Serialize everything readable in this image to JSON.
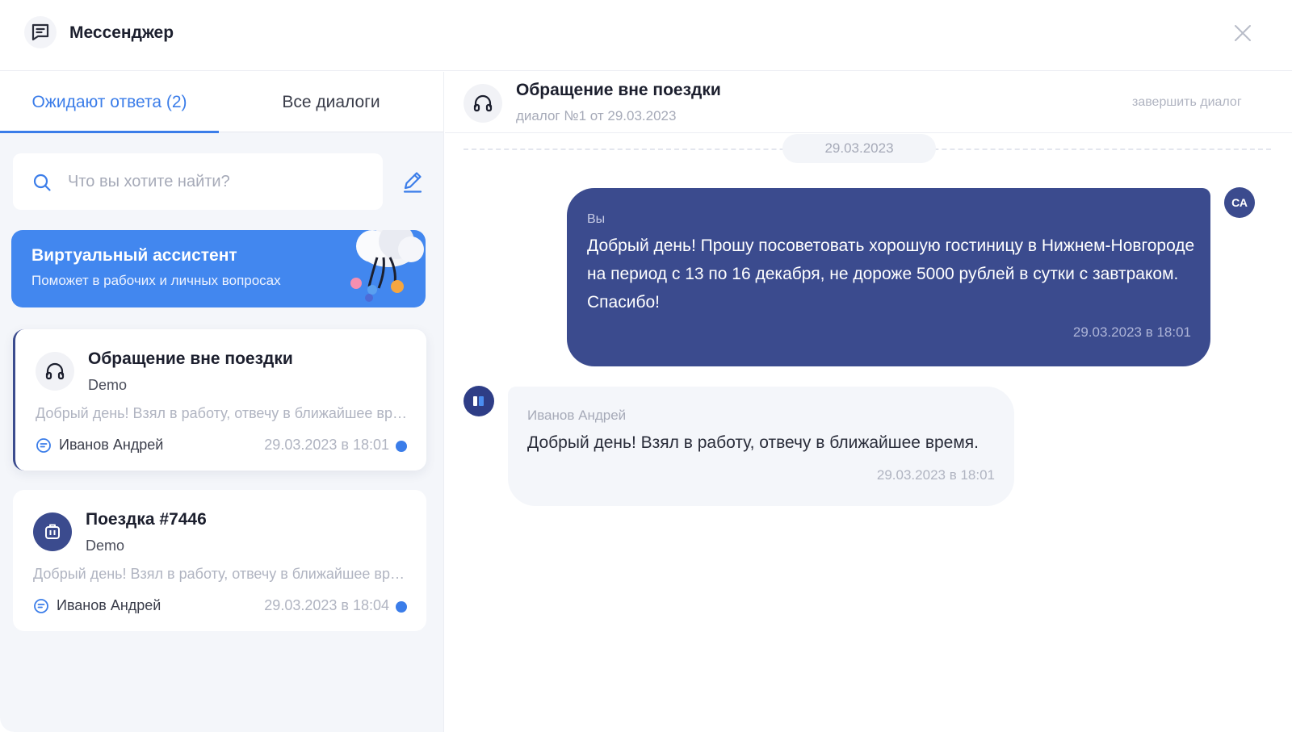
{
  "app": {
    "title": "Мессенджер"
  },
  "tabs": [
    {
      "label": "Ожидают ответа (2)",
      "active": true
    },
    {
      "label": "Все диалоги",
      "active": false
    }
  ],
  "search": {
    "placeholder": "Что вы хотите найти?",
    "value": ""
  },
  "assistant": {
    "title": "Виртуальный ассистент",
    "subtitle": "Поможет в рабочих и личных вопросах"
  },
  "dialogs": [
    {
      "title": "Обращение вне поездки",
      "subtitle": "Demo",
      "preview": "Добрый день! Взял в работу, отвечу в ближайшее время.",
      "agent": "Иванов Андрей",
      "time": "29.03.2023 в 18:01",
      "icon": "headset-icon",
      "unread": true,
      "selected": true
    },
    {
      "title": "Поездка #7446",
      "subtitle": "Demo",
      "preview": "Добрый день! Взял в работу, отвечу в ближайшее время.",
      "agent": "Иванов Андрей",
      "time": "29.03.2023 в 18:04",
      "icon": "suitcase-icon",
      "unread": true,
      "selected": false
    }
  ],
  "chat": {
    "title": "Обращение вне поездки",
    "subtitle": "диалог №1 от 29.03.2023",
    "end_label": "завершить диалог",
    "date_divider": "29.03.2023",
    "messages": [
      {
        "direction": "outgoing",
        "sender": "Вы",
        "text": "Добрый день! Прошу посоветовать хорошую гостиницу в Нижнем-Новгороде на период с 13 по 16 декабря, не дороже 5000 рублей в сутки с завтраком. Спасибо!",
        "time": "29.03.2023 в 18:01",
        "avatar_initials": "СА"
      },
      {
        "direction": "incoming",
        "sender": "Иванов Андрей",
        "text": "Добрый день! Взял в работу, отвечу в ближайшее время.",
        "time": "29.03.2023 в 18:01"
      }
    ]
  },
  "colors": {
    "accent": "#3b7de9",
    "brand_dark": "#3b4b8e",
    "assistant_card": "#4287ef",
    "sidebar_bg": "#f4f6fa"
  }
}
